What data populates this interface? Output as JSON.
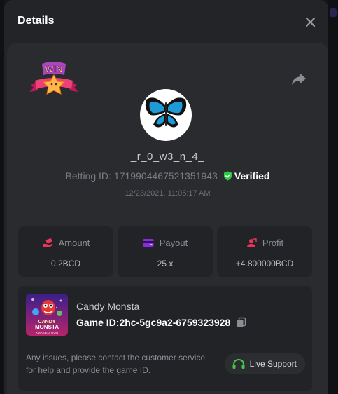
{
  "modal": {
    "title": "Details"
  },
  "icons": {
    "close": "close-icon",
    "share": "share-icon",
    "win_badge": "win-badge-icon",
    "verified": "shield-check-icon",
    "amount": "hand-coin-icon",
    "payout": "wallet-card-icon",
    "profit": "profit-person-icon",
    "copy": "copy-icon",
    "support": "headset-icon"
  },
  "win_badge_text": "WIN",
  "user": {
    "name": "_r_0_w3_n_4_",
    "betting_label": "Betting ID:",
    "betting_id": "1719904467521351943",
    "verified_label": "Verified",
    "timestamp": "12/23/2021, 11:05:17 AM"
  },
  "stats": [
    {
      "label": "Amount",
      "value": "0.2BCD"
    },
    {
      "label": "Payout",
      "value": "25 x"
    },
    {
      "label": "Profit",
      "value": "+4.800000BCD"
    }
  ],
  "game": {
    "name": "Candy Monsta",
    "id_text": "Game ID:2hc-5gc9a2-6759323928",
    "thumb_lines": [
      "CANDY",
      "MONSTA",
      "XMAS EDITION"
    ],
    "issue_text": "Any issues, please contact the customer service for help and provide the game ID.",
    "support_label": "Live Support"
  },
  "colors": {
    "background": "#1b1c1f",
    "panel": "#2a2b2f",
    "card": "#222326",
    "verified_green": "#2ecc40",
    "amount_icon": "#e8365a",
    "payout_icon": "#8a2be2",
    "profit_icon": "#e8365a",
    "support_icon": "#43c94a"
  }
}
